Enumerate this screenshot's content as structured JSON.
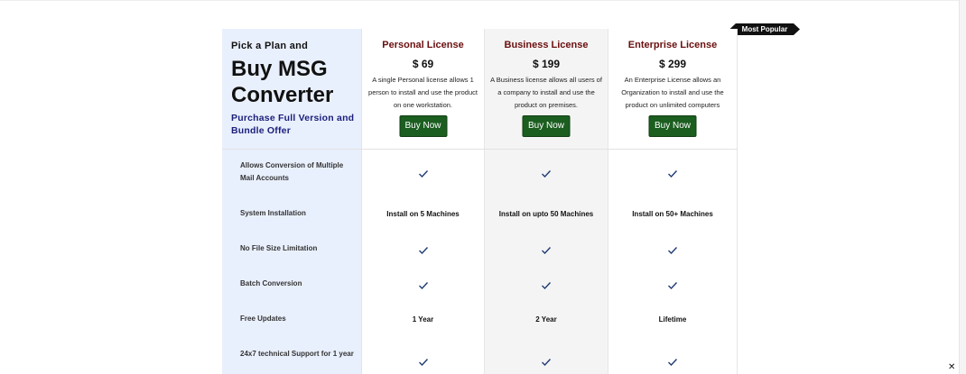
{
  "intro": {
    "small_title": "Pick a Plan and",
    "big_title": "Buy MSG Converter",
    "subtitle": "Purchase Full Version and Bundle Offer"
  },
  "badge": {
    "label": "Most Popular"
  },
  "plans": [
    {
      "title": "Personal License",
      "price": "$ 69",
      "description": "A single Personal license allows 1 person to install and use the product on one workstation.",
      "button": "Buy Now"
    },
    {
      "title": "Business License",
      "price": "$ 199",
      "description": "A Business license allows all users of a company to install and use the product on premises.",
      "button": "Buy Now"
    },
    {
      "title": "Enterprise License",
      "price": "$ 299",
      "description": "An Enterprise License allows an Organization to install and use the product on unlimited computers",
      "button": "Buy Now"
    }
  ],
  "features": [
    {
      "label": "Allows Conversion of Multiple Mail Accounts",
      "values": [
        "check",
        "check",
        "check"
      ]
    },
    {
      "label": "System Installation",
      "values": [
        "Install on 5 Machines",
        "Install on upto 50 Machines",
        "Install on 50+ Machines"
      ]
    },
    {
      "label": "No File Size Limitation",
      "values": [
        "check",
        "check",
        "check"
      ]
    },
    {
      "label": "Batch Conversion",
      "values": [
        "check",
        "check",
        "check"
      ]
    },
    {
      "label": "Free Updates",
      "values": [
        "1 Year",
        "2 Year",
        "Lifetime"
      ]
    },
    {
      "label": "24x7 technical Support for 1 year",
      "values": [
        "check",
        "check",
        "check"
      ]
    }
  ],
  "overlay": {
    "close": "✕",
    "corner": ""
  },
  "colors": {
    "accent_green": "#1b5e20",
    "plan_title": "#6b0f0f",
    "check_blue": "#1f3b73",
    "left_panel": "#e9f0fd",
    "subtitle_navy": "#1a1f7a"
  }
}
